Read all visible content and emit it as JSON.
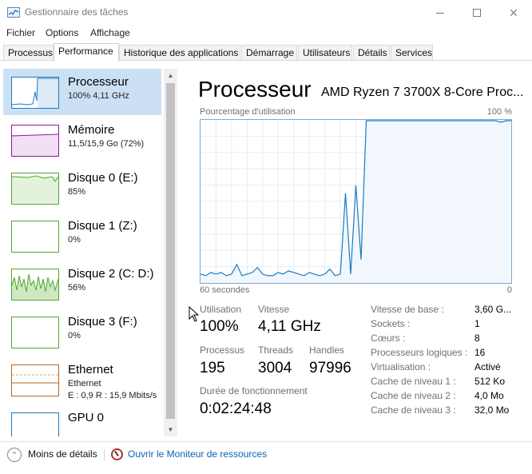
{
  "window": {
    "title": "Gestionnaire des tâches"
  },
  "menu": [
    "Fichier",
    "Options",
    "Affichage"
  ],
  "tabs": [
    "Processus",
    "Performance",
    "Historique des applications",
    "Démarrage",
    "Utilisateurs",
    "Détails",
    "Services"
  ],
  "active_tab": "Performance",
  "sidebar": {
    "items": [
      {
        "name": "Processeur",
        "sub": "100% 4,11 GHz",
        "sub2": "",
        "color": "#1a7ac0",
        "selected": true
      },
      {
        "name": "Mémoire",
        "sub": "11,5/15,9 Go (72%)",
        "sub2": "",
        "color": "#8b1a9a"
      },
      {
        "name": "Disque 0 (E:)",
        "sub": "85%",
        "sub2": "",
        "color": "#4da830"
      },
      {
        "name": "Disque 1 (Z:)",
        "sub": "0%",
        "sub2": "",
        "color": "#4da830"
      },
      {
        "name": "Disque 2 (C: D:)",
        "sub": "56%",
        "sub2": "",
        "color": "#4da830"
      },
      {
        "name": "Disque 3 (F:)",
        "sub": "0%",
        "sub2": "",
        "color": "#4da830"
      },
      {
        "name": "Ethernet",
        "sub": "Ethernet",
        "sub2": "E : 0,9  R : 15,9 Mbits/s",
        "color": "#b5651d"
      },
      {
        "name": "GPU 0",
        "sub": "",
        "sub2": "",
        "color": "#1a7ac0"
      }
    ]
  },
  "main": {
    "title": "Processeur",
    "cpu_model": "AMD Ryzen 7 3700X 8-Core Proc...",
    "graph_label": "Pourcentage d'utilisation",
    "graph_max": "100 %",
    "time_label": "60 secondes",
    "time_zero": "0",
    "accent": "#1a7ac0",
    "stats": {
      "utilisation_label": "Utilisation",
      "utilisation": "100%",
      "vitesse_label": "Vitesse",
      "vitesse": "4,11 GHz",
      "processus_label": "Processus",
      "processus": "195",
      "threads_label": "Threads",
      "threads": "3004",
      "handles_label": "Handles",
      "handles": "97996",
      "uptime_label": "Durée de fonctionnement",
      "uptime": "0:02:24:48"
    },
    "specs": [
      {
        "label": "Vitesse de base :",
        "value": "3,60 G..."
      },
      {
        "label": "Sockets :",
        "value": "1"
      },
      {
        "label": "Cœurs :",
        "value": "8"
      },
      {
        "label": "Processeurs logiques :",
        "value": "16"
      },
      {
        "label": "Virtualisation :",
        "value": "Activé"
      },
      {
        "label": "Cache de niveau 1 :",
        "value": "512 Ko"
      },
      {
        "label": "Cache de niveau 2 :",
        "value": "4,0 Mo"
      },
      {
        "label": "Cache de niveau 3 :",
        "value": "32,0 Mo"
      }
    ],
    "cpu_history_percent": [
      5,
      4,
      6,
      5,
      6,
      4,
      5,
      11,
      4,
      5,
      6,
      9,
      5,
      4,
      4,
      6,
      5,
      7,
      6,
      5,
      4,
      6,
      5,
      4,
      5,
      8,
      4,
      5,
      55,
      5,
      60,
      14,
      100,
      100,
      100,
      100,
      100,
      100,
      100,
      100,
      100,
      100,
      100,
      100,
      100,
      100,
      100,
      100,
      100,
      100,
      100,
      100,
      100,
      100,
      100,
      100,
      100,
      100,
      99,
      100,
      100
    ]
  },
  "footer": {
    "less_details": "Moins de détails",
    "monitor_link": "Ouvrir le Moniteur de ressources"
  }
}
